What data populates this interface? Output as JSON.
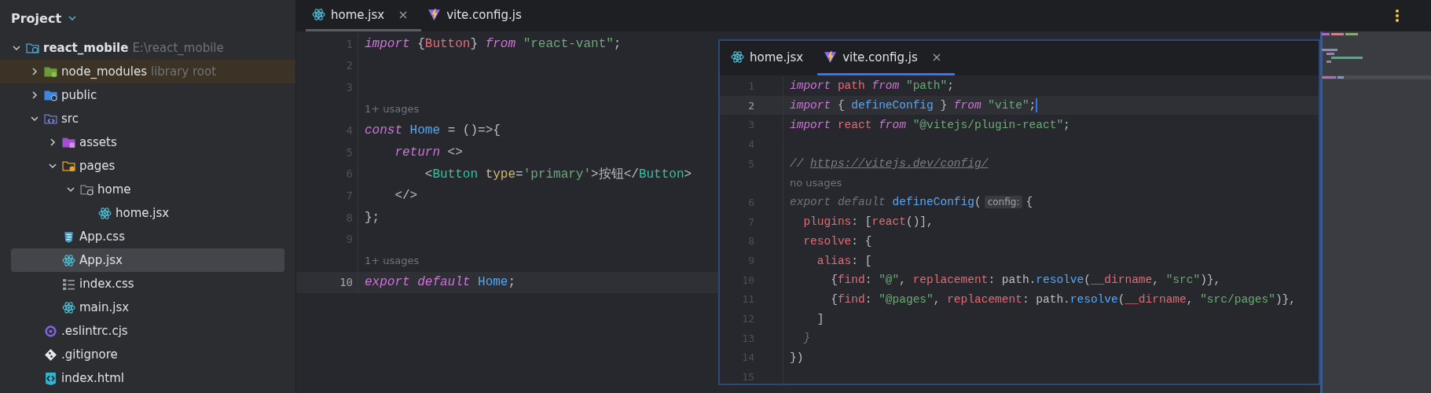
{
  "sidebar": {
    "title": "Project",
    "tree": [
      {
        "label": "react_mobile",
        "hint": "E:\\react_mobile",
        "kind": "project",
        "expanded": true,
        "selected": false,
        "children": [
          {
            "label": "node_modules",
            "hint": "library root",
            "kind": "library",
            "expanded": false,
            "selected": false
          },
          {
            "label": "public",
            "kind": "web",
            "expanded": false,
            "selected": false
          },
          {
            "label": "src",
            "kind": "source",
            "expanded": true,
            "selected": false,
            "children": [
              {
                "label": "assets",
                "kind": "resources",
                "expanded": false,
                "selected": false
              },
              {
                "label": "pages",
                "kind": "pages",
                "expanded": true,
                "selected": false,
                "children": [
                  {
                    "label": "home",
                    "kind": "folder",
                    "expanded": true,
                    "selected": false,
                    "children": [
                      {
                        "label": "home.jsx",
                        "kind": "react",
                        "selected": false
                      }
                    ]
                  }
                ]
              },
              {
                "label": "App.css",
                "kind": "css",
                "selected": false
              },
              {
                "label": "App.jsx",
                "kind": "react",
                "selected": true
              },
              {
                "label": "index.css",
                "kind": "stylesheet",
                "selected": false
              },
              {
                "label": "main.jsx",
                "kind": "react",
                "selected": false
              }
            ]
          },
          {
            "label": ".eslintrc.cjs",
            "kind": "eslint",
            "selected": false
          },
          {
            "label": ".gitignore",
            "kind": "git",
            "selected": false
          },
          {
            "label": "index.html",
            "kind": "html",
            "selected": false
          }
        ]
      }
    ]
  },
  "editor": {
    "focused": false,
    "tabs": [
      {
        "label": "home.jsx",
        "kind": "react",
        "selected": true
      },
      {
        "label": "vite.config.js",
        "kind": "vite",
        "selected": false
      }
    ],
    "rows": [
      {
        "kind": "code",
        "number": "1",
        "current": false,
        "tokens": [
          {
            "kind": "keyword",
            "text": "import"
          },
          {
            "kind": "plain",
            "text": " {"
          },
          {
            "kind": "variable",
            "text": "Button"
          },
          {
            "kind": "plain",
            "text": "} "
          },
          {
            "kind": "keyword",
            "text": "from"
          },
          {
            "kind": "string",
            "text": " \"react-vant\""
          },
          {
            "kind": "plain",
            "text": ";"
          }
        ]
      },
      {
        "kind": "code",
        "number": "2",
        "current": false
      },
      {
        "kind": "code",
        "number": "3",
        "current": false
      },
      {
        "kind": "hint",
        "text": "1+ usages"
      },
      {
        "kind": "code",
        "number": "4",
        "current": false,
        "tokens": [
          {
            "kind": "keyword",
            "text": "const"
          },
          {
            "kind": "function",
            "text": " Home"
          },
          {
            "kind": "plain",
            "text": " = ()=>{"
          }
        ]
      },
      {
        "kind": "code",
        "number": "5",
        "current": false,
        "tokens": [
          {
            "kind": "keyword",
            "text": "    return"
          },
          {
            "kind": "plain",
            "text": " <>"
          }
        ]
      },
      {
        "kind": "code",
        "number": "6",
        "current": false,
        "tokens": [
          {
            "kind": "plain",
            "text": "        <"
          },
          {
            "kind": "tag",
            "text": "Button"
          },
          {
            "kind": "attribute",
            "text": " type"
          },
          {
            "kind": "plain",
            "text": "="
          },
          {
            "kind": "string",
            "text": "'primary'"
          },
          {
            "kind": "plain",
            "text": ">按钮</"
          },
          {
            "kind": "tag",
            "text": "Button"
          },
          {
            "kind": "plain",
            "text": ">"
          }
        ]
      },
      {
        "kind": "code",
        "number": "7",
        "current": false,
        "tokens": [
          {
            "kind": "plain",
            "text": "    </>"
          }
        ]
      },
      {
        "kind": "code",
        "number": "8",
        "current": false,
        "tokens": [
          {
            "kind": "plain",
            "text": "};"
          }
        ]
      },
      {
        "kind": "code",
        "number": "9",
        "current": false
      },
      {
        "kind": "hint",
        "text": "1+ usages"
      },
      {
        "kind": "code",
        "number": "10",
        "current": true,
        "tokens": [
          {
            "kind": "keyword",
            "text": "export default"
          },
          {
            "kind": "function",
            "text": " Home"
          },
          {
            "kind": "plain",
            "text": ";"
          }
        ]
      }
    ]
  },
  "popup": {
    "focused": true,
    "tabs": [
      {
        "label": "home.jsx",
        "kind": "react",
        "selected": false
      },
      {
        "label": "vite.config.js",
        "kind": "vite",
        "selected": true
      }
    ],
    "rows": [
      {
        "kind": "code",
        "number": "1",
        "current": false,
        "tokens": [
          {
            "kind": "keyword",
            "text": "import"
          },
          {
            "kind": "variable",
            "text": " path"
          },
          {
            "kind": "keyword",
            "text": " from"
          },
          {
            "kind": "string",
            "text": " \"path\""
          },
          {
            "kind": "plain",
            "text": ";"
          }
        ]
      },
      {
        "kind": "code",
        "number": "2",
        "current": true,
        "tokens": [
          {
            "kind": "keyword",
            "text": "import"
          },
          {
            "kind": "plain",
            "text": " { "
          },
          {
            "kind": "function",
            "text": "defineConfig"
          },
          {
            "kind": "plain",
            "text": " } "
          },
          {
            "kind": "keyword",
            "text": "from"
          },
          {
            "kind": "string",
            "text": " \"vite\""
          },
          {
            "kind": "plain",
            "text": ";"
          }
        ]
      },
      {
        "kind": "code",
        "number": "3",
        "current": false,
        "tokens": [
          {
            "kind": "keyword",
            "text": "import"
          },
          {
            "kind": "variable",
            "text": " react"
          },
          {
            "kind": "keyword",
            "text": " from"
          },
          {
            "kind": "string",
            "text": " \"@vitejs/plugin-react\""
          },
          {
            "kind": "plain",
            "text": ";"
          }
        ]
      },
      {
        "kind": "code",
        "number": "4",
        "current": false
      },
      {
        "kind": "code",
        "number": "5",
        "current": false,
        "tokens": [
          {
            "kind": "comment",
            "text": "// "
          },
          {
            "kind": "link",
            "text": "https://vitejs.dev/config/"
          }
        ]
      },
      {
        "kind": "hint",
        "text": "no usages"
      },
      {
        "kind": "code",
        "number": "6",
        "current": false,
        "tokens": [
          {
            "kind": "dim",
            "text": "export default"
          },
          {
            "kind": "function",
            "text": " defineConfig"
          },
          {
            "kind": "plain",
            "text": "("
          },
          {
            "kind": "inlay",
            "text": "config:"
          },
          {
            "kind": "plain",
            "text": "{"
          }
        ]
      },
      {
        "kind": "code",
        "number": "7",
        "current": false,
        "tokens": [
          {
            "kind": "variable",
            "text": "  plugins"
          },
          {
            "kind": "plain",
            "text": ": ["
          },
          {
            "kind": "variable",
            "text": "react"
          },
          {
            "kind": "plain",
            "text": "()],"
          }
        ]
      },
      {
        "kind": "code",
        "number": "8",
        "current": false,
        "tokens": [
          {
            "kind": "variable",
            "text": "  resolve"
          },
          {
            "kind": "plain",
            "text": ": {"
          }
        ]
      },
      {
        "kind": "code",
        "number": "9",
        "current": false,
        "tokens": [
          {
            "kind": "variable",
            "text": "    alias"
          },
          {
            "kind": "plain",
            "text": ": ["
          }
        ]
      },
      {
        "kind": "code",
        "number": "10",
        "current": false,
        "tokens": [
          {
            "kind": "plain",
            "text": "      {"
          },
          {
            "kind": "variable",
            "text": "find"
          },
          {
            "kind": "plain",
            "text": ": "
          },
          {
            "kind": "string",
            "text": "\"@\""
          },
          {
            "kind": "plain",
            "text": ", "
          },
          {
            "kind": "variable",
            "text": "replacement"
          },
          {
            "kind": "plain",
            "text": ": path."
          },
          {
            "kind": "function",
            "text": "resolve"
          },
          {
            "kind": "plain",
            "text": "("
          },
          {
            "kind": "variable",
            "text": "__dirname"
          },
          {
            "kind": "plain",
            "text": ", "
          },
          {
            "kind": "string",
            "text": "\"src\""
          },
          {
            "kind": "plain",
            "text": ")},"
          }
        ]
      },
      {
        "kind": "code",
        "number": "11",
        "current": false,
        "tokens": [
          {
            "kind": "plain",
            "text": "      {"
          },
          {
            "kind": "variable",
            "text": "find"
          },
          {
            "kind": "plain",
            "text": ": "
          },
          {
            "kind": "string",
            "text": "\"@pages\""
          },
          {
            "kind": "plain",
            "text": ", "
          },
          {
            "kind": "variable",
            "text": "replacement"
          },
          {
            "kind": "plain",
            "text": ": path."
          },
          {
            "kind": "function",
            "text": "resolve"
          },
          {
            "kind": "plain",
            "text": "("
          },
          {
            "kind": "variable",
            "text": "__dirname"
          },
          {
            "kind": "plain",
            "text": ", "
          },
          {
            "kind": "string",
            "text": "\"src/pages\""
          },
          {
            "kind": "plain",
            "text": ")},"
          }
        ]
      },
      {
        "kind": "code",
        "number": "12",
        "current": false,
        "tokens": [
          {
            "kind": "plain",
            "text": "    ]"
          }
        ]
      },
      {
        "kind": "code",
        "number": "13",
        "current": false,
        "tokens": [
          {
            "kind": "dim",
            "text": "  }"
          }
        ]
      },
      {
        "kind": "code",
        "number": "14",
        "current": false,
        "tokens": [
          {
            "kind": "plain",
            "text": "})"
          }
        ]
      },
      {
        "kind": "code",
        "number": "15",
        "current": false
      }
    ]
  }
}
